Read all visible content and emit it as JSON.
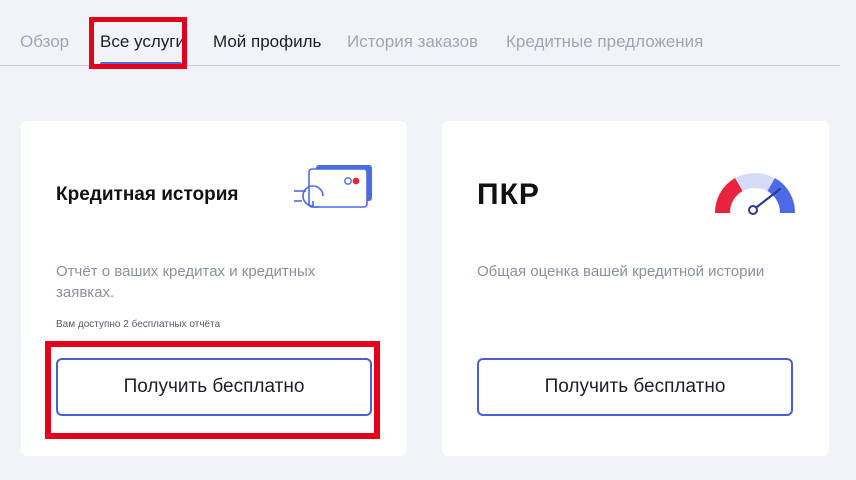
{
  "tabs": [
    {
      "label": "Обзор",
      "state": "inactive"
    },
    {
      "label": "Все услуги",
      "state": "active"
    },
    {
      "label": "Мой профиль",
      "state": "inactive"
    },
    {
      "label": "История заказов",
      "state": "inactive"
    },
    {
      "label": "Кредитные предложения",
      "state": "inactive"
    }
  ],
  "cards": {
    "credit_history": {
      "title": "Кредитная история",
      "description": "Отчёт о ваших кредитах и кредитных заявках.",
      "note": "Вам доступно 2 бесплатных отчёта",
      "button_label": "Получить бесплатно",
      "icon": "credit-card-refresh-icon"
    },
    "pkr": {
      "title": "ПКР",
      "description": "Общая оценка вашей кредитной истории",
      "button_label": "Получить бесплатно",
      "icon": "gauge-icon"
    }
  },
  "colors": {
    "accent": "#4a5fd0",
    "highlight": "#e3001b",
    "background": "#f2f3f7",
    "gauge_red": "#e8233d",
    "gauge_blue": "#4d6ae6"
  }
}
